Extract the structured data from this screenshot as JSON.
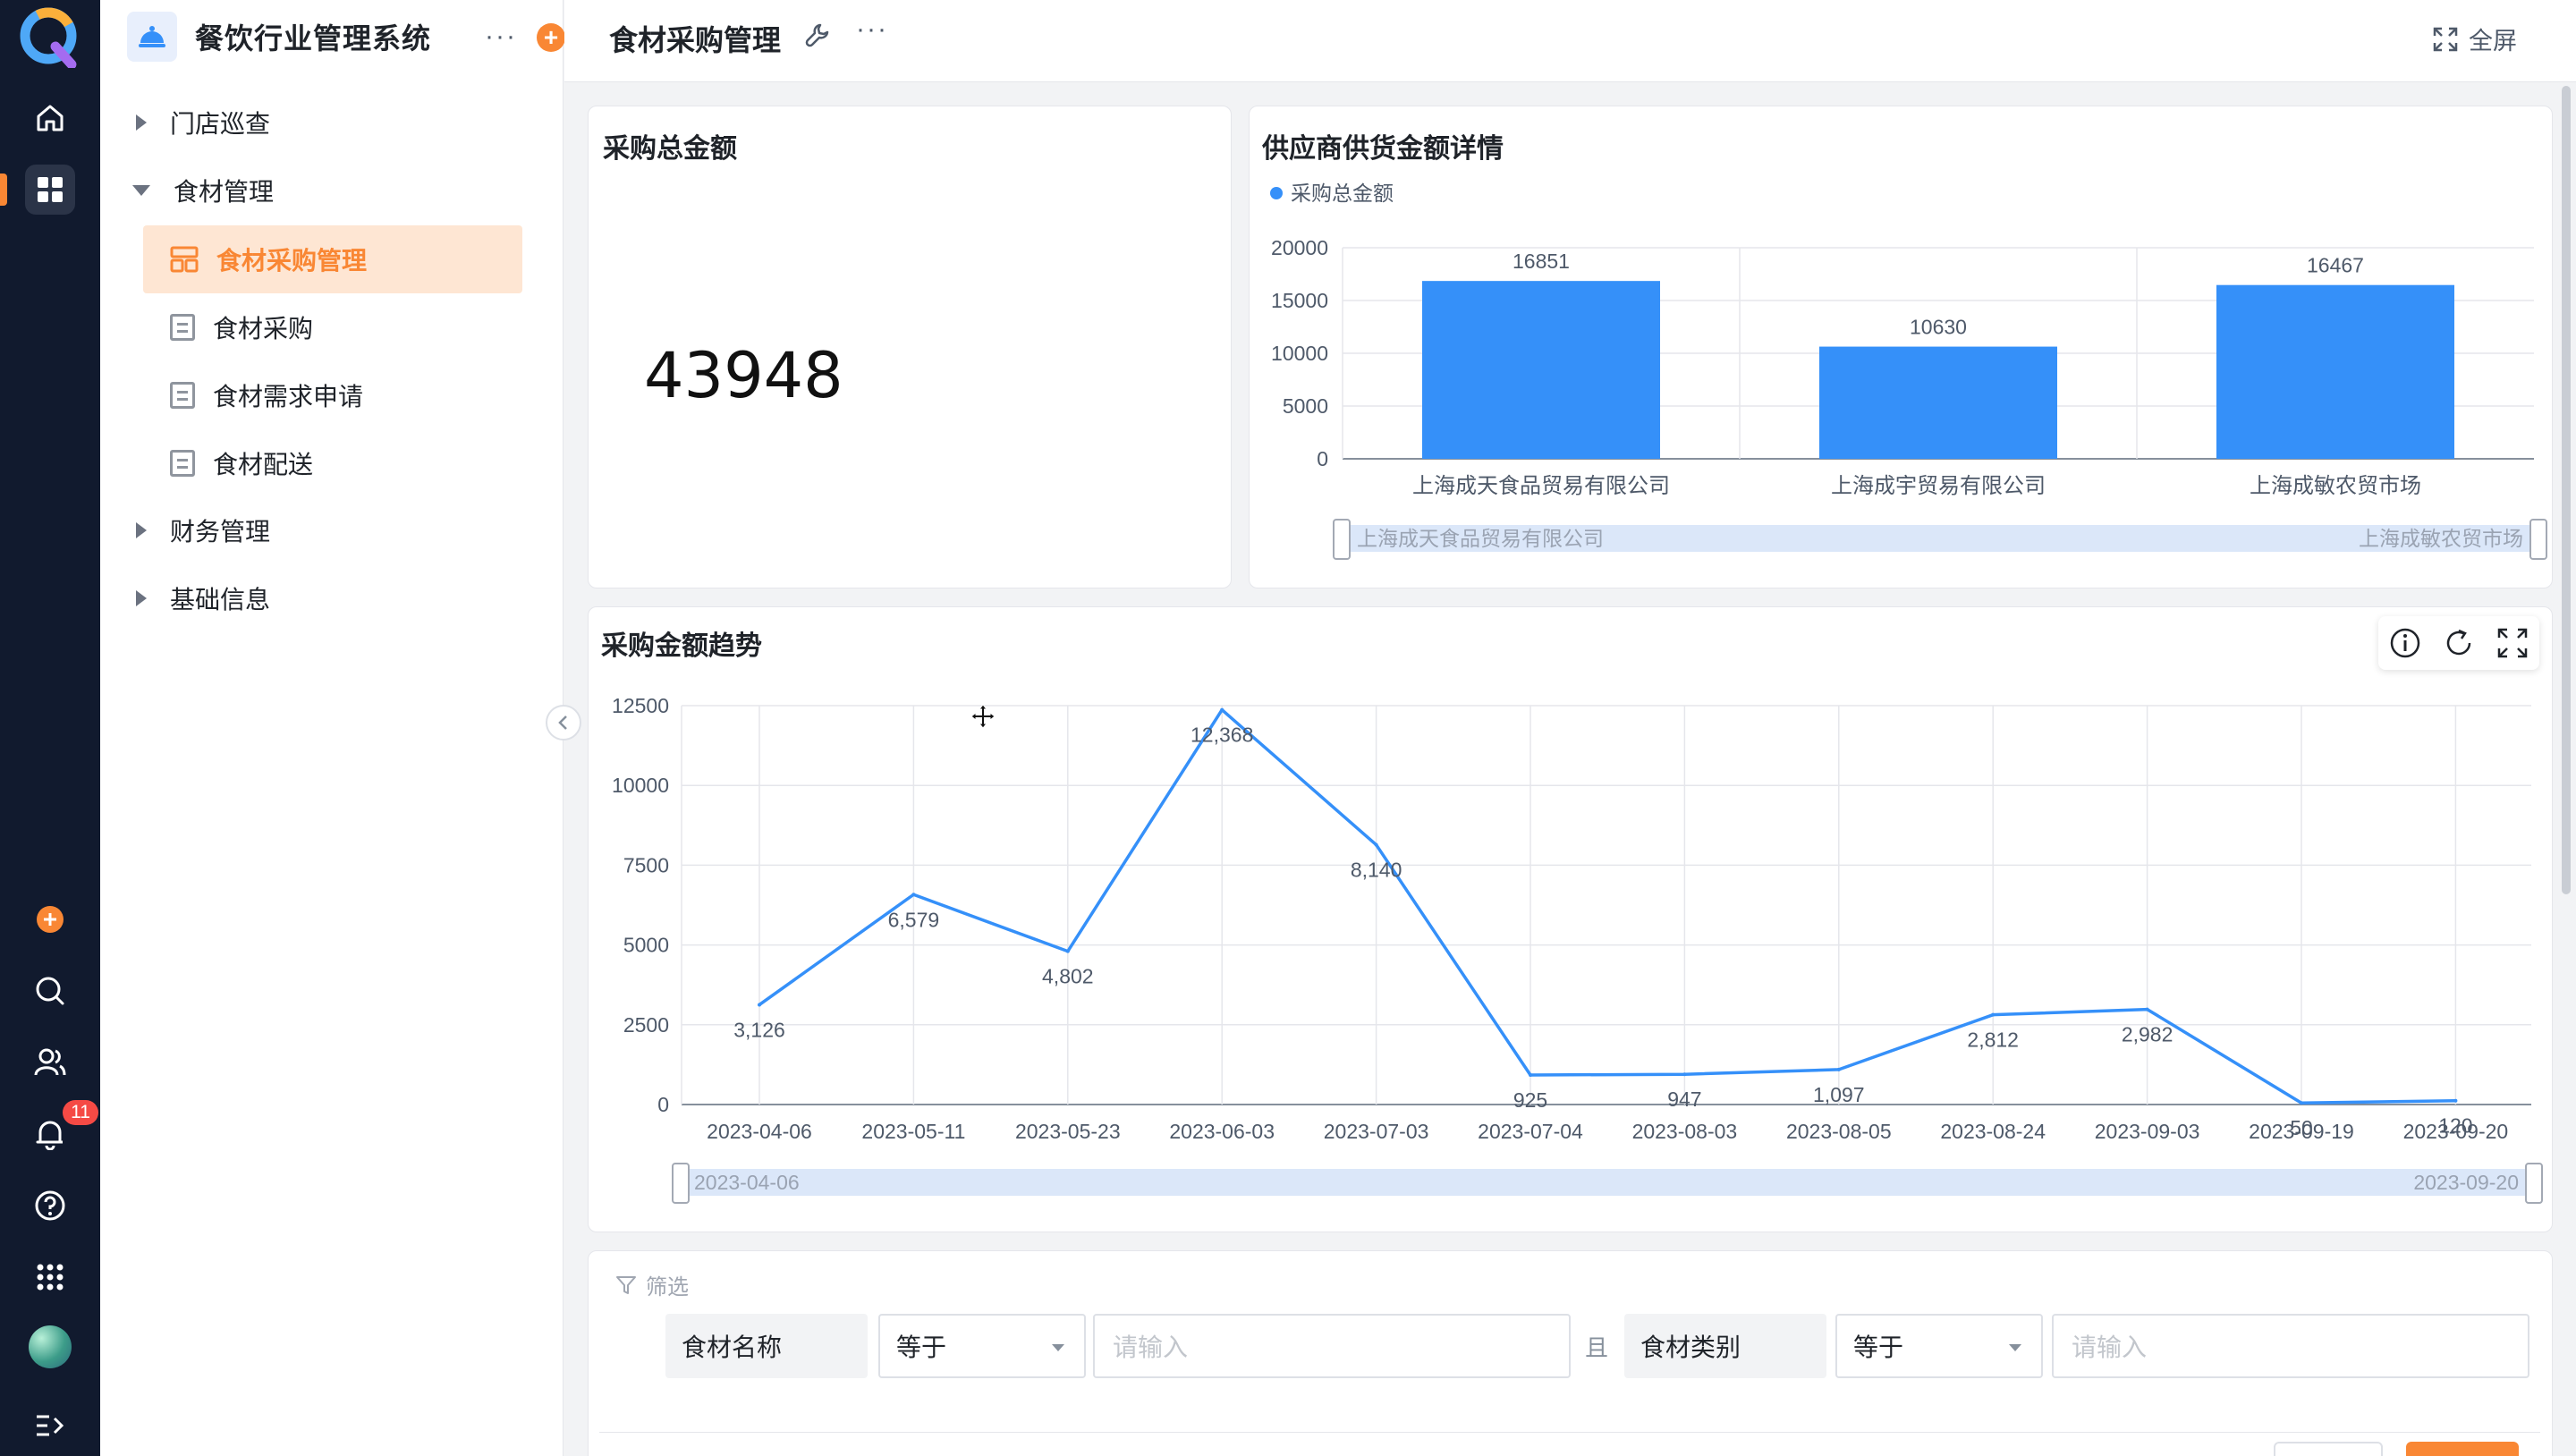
{
  "app": {
    "title": "餐饮行业管理系统",
    "notification_count": "11"
  },
  "sidebar": {
    "groups": [
      {
        "label": "门店巡查"
      },
      {
        "label": "食材管理"
      },
      {
        "label": "财务管理"
      },
      {
        "label": "基础信息"
      }
    ],
    "sub_items": [
      {
        "label": "食材采购管理"
      },
      {
        "label": "食材采购"
      },
      {
        "label": "食材需求申请"
      },
      {
        "label": "食材配送"
      }
    ]
  },
  "page": {
    "title": "食材采购管理",
    "fullscreen_label": "全屏"
  },
  "total_card": {
    "title": "采购总金额",
    "value": "43948"
  },
  "supplier_card": {
    "title": "供应商供货金额详情",
    "slider_start": "上海成天食品贸易有限公司",
    "slider_end": "上海成敏农贸市场"
  },
  "trend_card": {
    "title": "采购金额趋势",
    "slider_start": "2023-04-06",
    "slider_end": "2023-09-20"
  },
  "filter": {
    "label": "筛选",
    "conj": "且",
    "fields": [
      {
        "name": "食材名称",
        "op": "等于",
        "placeholder": "请输入"
      },
      {
        "name": "食材类别",
        "op": "等于",
        "placeholder": "请输入"
      }
    ]
  },
  "colors": {
    "accent": "#f98734",
    "series": "#3590f9",
    "rail": "#111a2e"
  },
  "chart_data": [
    {
      "type": "bar",
      "title": "供应商供货金额详情",
      "categories": [
        "上海成天食品贸易有限公司",
        "上海成宇贸易有限公司",
        "上海成敏农贸市场"
      ],
      "series": [
        {
          "name": "采购总金额",
          "values": [
            16851,
            10630,
            16467
          ]
        }
      ],
      "ylim": [
        0,
        20000
      ],
      "yticks": [
        "0",
        "5000",
        "10000",
        "15000",
        "20000"
      ],
      "data_labels": [
        "16851",
        "10630",
        "16467"
      ],
      "legend": "top-left",
      "grid": true
    },
    {
      "type": "line",
      "title": "采购金额趋势",
      "categories": [
        "2023-04-06",
        "2023-05-11",
        "2023-05-23",
        "2023-06-03",
        "2023-07-03",
        "2023-07-04",
        "2023-08-03",
        "2023-08-05",
        "2023-08-24",
        "2023-09-03",
        "2023-09-19",
        "2023-09-20"
      ],
      "series": [
        {
          "values": [
            3126,
            6579,
            4802,
            12368,
            8140,
            925,
            947,
            1097,
            2812,
            2982,
            50,
            120
          ]
        }
      ],
      "data_labels": [
        "3,126",
        "6,579",
        "4,802",
        "12,368",
        "8,140",
        "925",
        "947",
        "1,097",
        "2,812",
        "2,982",
        "50",
        "120"
      ],
      "ylim": [
        0,
        12500
      ],
      "yticks": [
        "0",
        "2500",
        "5000",
        "7500",
        "10000",
        "12500"
      ],
      "grid": true
    }
  ]
}
